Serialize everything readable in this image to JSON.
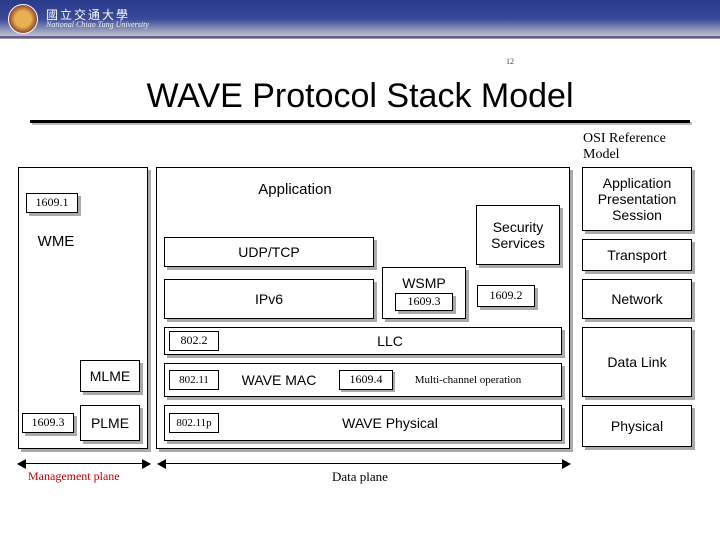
{
  "header": {
    "uni_main": "國立交通大學",
    "uni_sub": "National Chiao Tung University"
  },
  "page_number": "12",
  "title": "WAVE Protocol Stack Model",
  "osi": {
    "heading": "OSI Reference Model",
    "layers": {
      "app_pres_sess": "Application\nPresentation\nSession",
      "transport": "Transport",
      "network": "Network",
      "datalink": "Data Link",
      "physical": "Physical"
    }
  },
  "stack": {
    "app": "Application",
    "udp_tcp": "UDP/TCP",
    "ipv6": "IPv6",
    "wsmp": "WSMP",
    "wsmp_std": "1609.3",
    "security": "Security\nServices",
    "security_std": "1609.2",
    "llc_std": "802.2",
    "llc": "LLC",
    "mac_std": "802.11",
    "mac": "WAVE MAC",
    "mco_std": "1609.4",
    "mco": "Multi-channel operation",
    "phy_std": "802.11p",
    "phy": "WAVE Physical"
  },
  "mgmt": {
    "mgmt_std": "1609.1",
    "wme": "WME",
    "mlme": "MLME",
    "plme_std": "1609.3",
    "plme": "PLME"
  },
  "planes": {
    "mgmt": "Management plane",
    "data": "Data plane"
  }
}
